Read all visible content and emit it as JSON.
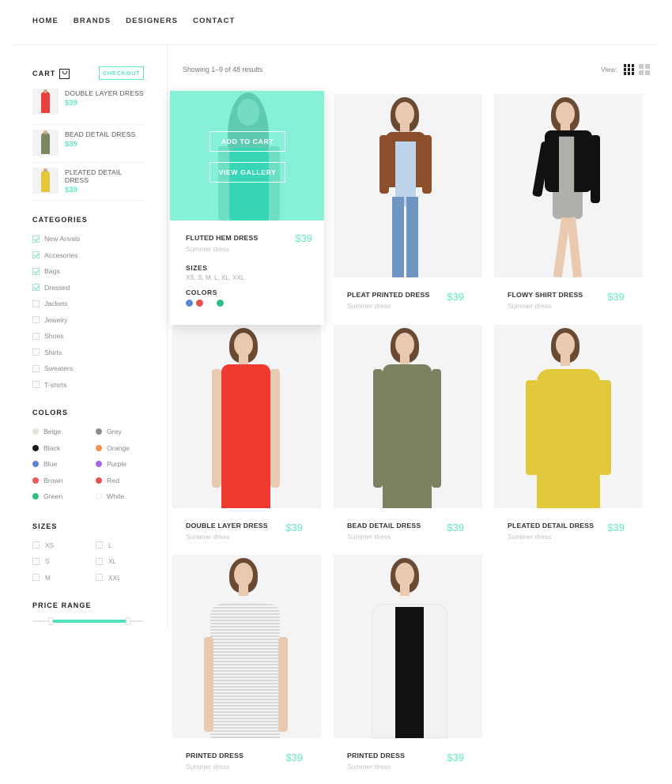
{
  "nav": {
    "items": [
      "HOME",
      "BRANDS",
      "DESIGNERS",
      "CONTACT"
    ]
  },
  "sidebar": {
    "cart": {
      "title": "CART",
      "icon": "shopping-bag-icon",
      "checkout_label": "CHECKOUT",
      "items": [
        {
          "name": "DOUBLE LAYER DRESS",
          "price": "$39",
          "color": "#e8403a"
        },
        {
          "name": "BEAD DETAIL DRESS",
          "price": "$39",
          "color": "#7d8663"
        },
        {
          "name": "PLEATED DETAIL DRESS",
          "price": "$39",
          "color": "#e4c73a"
        }
      ]
    },
    "categories": {
      "title": "CATEGORIES",
      "items": [
        {
          "label": "New Arivals",
          "checked": true
        },
        {
          "label": "Accesories",
          "checked": true
        },
        {
          "label": "Bags",
          "checked": true
        },
        {
          "label": "Dressed",
          "checked": true
        },
        {
          "label": "Jackets",
          "checked": false
        },
        {
          "label": "Jewelry",
          "checked": false
        },
        {
          "label": "Shoes",
          "checked": false
        },
        {
          "label": "Shirts",
          "checked": false
        },
        {
          "label": "Sweaters",
          "checked": false
        },
        {
          "label": "T-shirts",
          "checked": false
        }
      ]
    },
    "colors": {
      "title": "COLORS",
      "items": [
        {
          "label": "Beige",
          "hex": "#e5e3d6"
        },
        {
          "label": "Grey",
          "hex": "#8c8c8c"
        },
        {
          "label": "Black",
          "hex": "#1a1a1a"
        },
        {
          "label": "Orange",
          "hex": "#f5914f"
        },
        {
          "label": "Blue",
          "hex": "#5b86d6"
        },
        {
          "label": "Purple",
          "hex": "#a765e8"
        },
        {
          "label": "Brown",
          "hex": "#ea5a5a"
        },
        {
          "label": "Red",
          "hex": "#ea5050"
        },
        {
          "label": "Green",
          "hex": "#2fbf86"
        },
        {
          "label": "White",
          "hex": "#ffffff"
        }
      ]
    },
    "sizes": {
      "title": "SIZES",
      "items": [
        {
          "label": "XS",
          "checked": false
        },
        {
          "label": "L",
          "checked": false
        },
        {
          "label": "S",
          "checked": false
        },
        {
          "label": "XL",
          "checked": false
        },
        {
          "label": "M",
          "checked": false
        },
        {
          "label": "XXL",
          "checked": false
        }
      ]
    },
    "price_range": {
      "title": "PRICE RANGE",
      "min_fraction": 0.16,
      "max_fraction": 0.86
    }
  },
  "main": {
    "results_text": "Showing 1–9 of 48 results",
    "view_label": "View:",
    "accent": "#63e7c7",
    "featured": {
      "name": "FLUTED HEM DRESS",
      "subtitle": "Summer dress",
      "price": "$39",
      "add_to_cart_label": "ADD TO CART",
      "view_gallery_label": "VIEW GALLERY",
      "sizes_label": "SIZES",
      "sizes_value": "XS, S, M, L, XL, XXL",
      "colors_label": "COLORS",
      "colors": [
        "#5b86d6",
        "#ea5050",
        "#ffffff",
        "#2fbf86"
      ]
    },
    "products": [
      {
        "name": "PLEAT PRINTED DRESS",
        "subtitle": "Summer dress",
        "price": "$39",
        "top": "#8b4f2c",
        "bottom": "#6f95c2",
        "style": "jacket-jeans"
      },
      {
        "name": "FLOWY SHIRT DRESS",
        "subtitle": "Summer dress",
        "price": "$39",
        "top": "#111111",
        "bottom": "#b0b0aa",
        "style": "jacket-dress"
      },
      {
        "name": "DOUBLE LAYER DRESS",
        "subtitle": "Summer dress",
        "price": "$39",
        "top": "#ee3a30",
        "bottom": "#ee3a30",
        "style": "dress"
      },
      {
        "name": "BEAD DETAIL DRESS",
        "subtitle": "Summer dress",
        "price": "$39",
        "top": "#7b8262",
        "bottom": "#7b8262",
        "style": "dress"
      },
      {
        "name": "PLEATED DETAIL DRESS",
        "subtitle": "Summer dress",
        "price": "$39",
        "top": "#e2c93b",
        "bottom": "#e2c93b",
        "style": "top"
      },
      {
        "name": "PRINTED DRESS",
        "subtitle": "Summer dress",
        "price": "$39",
        "top": "#c9c9c9",
        "bottom": "#c9c9c9",
        "style": "tshirt"
      },
      {
        "name": "PRINTED DRESS",
        "subtitle": "Summer dress",
        "price": "$39",
        "top": "#f2f2f2",
        "bottom": "#111111",
        "style": "blazer"
      }
    ]
  }
}
